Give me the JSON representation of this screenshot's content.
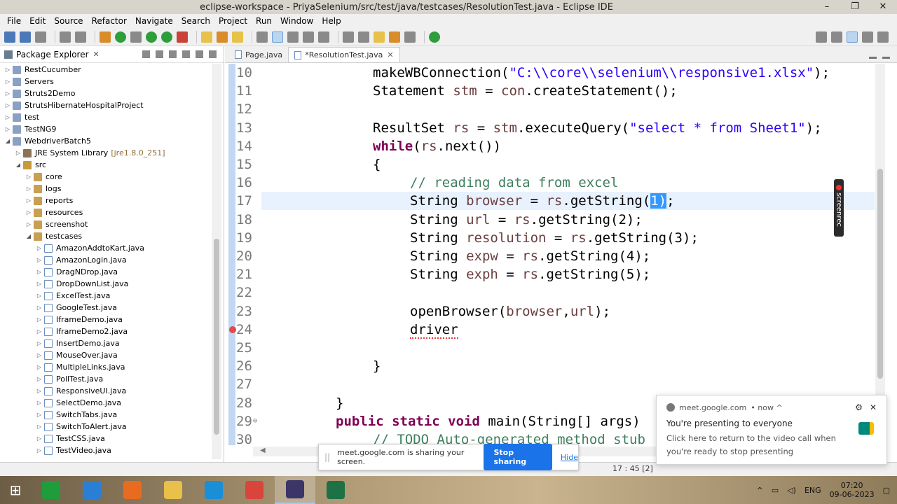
{
  "window": {
    "title": "eclipse-workspace - PriyaSelenium/src/test/java/testcases/ResolutionTest.java - Eclipse IDE",
    "controls": [
      "–",
      "❐",
      "✕"
    ]
  },
  "menu": [
    "File",
    "Edit",
    "Source",
    "Refactor",
    "Navigate",
    "Search",
    "Project",
    "Run",
    "Window",
    "Help"
  ],
  "explorer": {
    "title": "Package Explorer",
    "close": "✕",
    "items": [
      {
        "label": "RestCucumber",
        "arrow": "▷",
        "type": "proj",
        "indent": 0
      },
      {
        "label": "Servers",
        "arrow": "▷",
        "type": "proj",
        "indent": 0
      },
      {
        "label": "Struts2Demo",
        "arrow": "▷",
        "type": "proj",
        "indent": 0
      },
      {
        "label": "StrutsHibernateHospitalProject",
        "arrow": "▷",
        "type": "proj",
        "indent": 0
      },
      {
        "label": "test",
        "arrow": "▷",
        "type": "proj",
        "indent": 0
      },
      {
        "label": "TestNG9",
        "arrow": "▷",
        "type": "proj",
        "indent": 0
      },
      {
        "label": "WebdriverBatch5",
        "arrow": "◢",
        "type": "proj",
        "indent": 0
      },
      {
        "label": "JRE System Library",
        "extra": "[jre1.8.0_251]",
        "arrow": "▷",
        "type": "jar",
        "indent": 1
      },
      {
        "label": "src",
        "arrow": "◢",
        "type": "src",
        "indent": 1
      },
      {
        "label": "core",
        "arrow": "▷",
        "type": "pkg",
        "indent": 2
      },
      {
        "label": "logs",
        "arrow": "▷",
        "type": "pkg",
        "indent": 2
      },
      {
        "label": "reports",
        "arrow": "▷",
        "type": "pkg",
        "indent": 2
      },
      {
        "label": "resources",
        "arrow": "▷",
        "type": "pkg",
        "indent": 2
      },
      {
        "label": "screenshot",
        "arrow": "▷",
        "type": "pkg",
        "indent": 2
      },
      {
        "label": "testcases",
        "arrow": "◢",
        "type": "pkg",
        "indent": 2
      },
      {
        "label": "AmazonAddtoKart.java",
        "arrow": "▷",
        "type": "java",
        "indent": 3
      },
      {
        "label": "AmazonLogin.java",
        "arrow": "▷",
        "type": "java",
        "indent": 3
      },
      {
        "label": "DragNDrop.java",
        "arrow": "▷",
        "type": "java",
        "indent": 3
      },
      {
        "label": "DropDownList.java",
        "arrow": "▷",
        "type": "java",
        "indent": 3
      },
      {
        "label": "ExcelTest.java",
        "arrow": "▷",
        "type": "java",
        "indent": 3
      },
      {
        "label": "GoogleTest.java",
        "arrow": "▷",
        "type": "java",
        "indent": 3
      },
      {
        "label": "IframeDemo.java",
        "arrow": "▷",
        "type": "java",
        "indent": 3
      },
      {
        "label": "IframeDemo2.java",
        "arrow": "▷",
        "type": "java",
        "indent": 3
      },
      {
        "label": "InsertDemo.java",
        "arrow": "▷",
        "type": "java",
        "indent": 3
      },
      {
        "label": "MouseOver.java",
        "arrow": "▷",
        "type": "java",
        "indent": 3
      },
      {
        "label": "MultipleLinks.java",
        "arrow": "▷",
        "type": "java",
        "indent": 3
      },
      {
        "label": "PollTest.java",
        "arrow": "▷",
        "type": "java",
        "indent": 3
      },
      {
        "label": "ResponsiveUI.java",
        "arrow": "▷",
        "type": "java",
        "indent": 3
      },
      {
        "label": "SelectDemo.java",
        "arrow": "▷",
        "type": "java",
        "indent": 3
      },
      {
        "label": "SwitchTabs.java",
        "arrow": "▷",
        "type": "java",
        "indent": 3
      },
      {
        "label": "SwitchToAlert.java",
        "arrow": "▷",
        "type": "java",
        "indent": 3
      },
      {
        "label": "TestCSS.java",
        "arrow": "▷",
        "type": "java",
        "indent": 3
      },
      {
        "label": "TestVideo.java",
        "arrow": "▷",
        "type": "java",
        "indent": 3
      }
    ]
  },
  "editor": {
    "tabs": [
      {
        "label": "Page.java",
        "active": false
      },
      {
        "label": "*ResolutionTest.java",
        "active": true,
        "close": "✕"
      }
    ],
    "lines": [
      {
        "num": "10",
        "indent": 2,
        "tokens": [
          [
            "p",
            "makeWBConnection("
          ],
          [
            "s",
            "\"C:\\\\core\\\\selenium\\\\responsive1.xlsx\""
          ],
          [
            "p",
            ");"
          ]
        ]
      },
      {
        "num": "11",
        "indent": 2,
        "tokens": [
          [
            "p",
            "Statement "
          ],
          [
            "v",
            "stm"
          ],
          [
            "p",
            " = "
          ],
          [
            "v",
            "con"
          ],
          [
            "p",
            ".createStatement();"
          ]
        ]
      },
      {
        "num": "12",
        "indent": 0,
        "tokens": []
      },
      {
        "num": "13",
        "indent": 2,
        "tokens": [
          [
            "p",
            "ResultSet "
          ],
          [
            "v",
            "rs"
          ],
          [
            "p",
            " = "
          ],
          [
            "v",
            "stm"
          ],
          [
            "p",
            ".executeQuery("
          ],
          [
            "s",
            "\"select * from Sheet1\""
          ],
          [
            "p",
            ");"
          ]
        ]
      },
      {
        "num": "14",
        "indent": 2,
        "tokens": [
          [
            "k",
            "while"
          ],
          [
            "p",
            "("
          ],
          [
            "v",
            "rs"
          ],
          [
            "p",
            ".next())"
          ]
        ]
      },
      {
        "num": "15",
        "indent": 2,
        "tokens": [
          [
            "p",
            "{"
          ]
        ]
      },
      {
        "num": "16",
        "indent": 3,
        "tokens": [
          [
            "c",
            "// reading data from excel"
          ]
        ]
      },
      {
        "num": "17",
        "indent": 3,
        "current": true,
        "tokens": [
          [
            "p",
            "String "
          ],
          [
            "v",
            "browser"
          ],
          [
            "p",
            " = "
          ],
          [
            "v",
            "rs"
          ],
          [
            "p",
            ".getString("
          ],
          [
            "sel",
            "1)"
          ],
          [
            "p",
            ";"
          ]
        ]
      },
      {
        "num": "18",
        "indent": 3,
        "tokens": [
          [
            "p",
            "String "
          ],
          [
            "v",
            "url"
          ],
          [
            "p",
            " = "
          ],
          [
            "v",
            "rs"
          ],
          [
            "p",
            ".getString(2);"
          ]
        ]
      },
      {
        "num": "19",
        "indent": 3,
        "tokens": [
          [
            "p",
            "String "
          ],
          [
            "v",
            "resolution"
          ],
          [
            "p",
            " = "
          ],
          [
            "v",
            "rs"
          ],
          [
            "p",
            ".getString(3);"
          ]
        ]
      },
      {
        "num": "20",
        "indent": 3,
        "tokens": [
          [
            "p",
            "String "
          ],
          [
            "v",
            "expw"
          ],
          [
            "p",
            " = "
          ],
          [
            "v",
            "rs"
          ],
          [
            "p",
            ".getString(4);"
          ]
        ]
      },
      {
        "num": "21",
        "indent": 3,
        "tokens": [
          [
            "p",
            "String "
          ],
          [
            "v",
            "exph"
          ],
          [
            "p",
            " = "
          ],
          [
            "v",
            "rs"
          ],
          [
            "p",
            ".getString(5);"
          ]
        ]
      },
      {
        "num": "22",
        "indent": 0,
        "tokens": []
      },
      {
        "num": "23",
        "indent": 3,
        "tokens": [
          [
            "p",
            "openBrowser("
          ],
          [
            "v",
            "browser"
          ],
          [
            "p",
            ","
          ],
          [
            "v",
            "url"
          ],
          [
            "p",
            ");"
          ]
        ]
      },
      {
        "num": "24",
        "indent": 3,
        "error": true,
        "tokens": [
          [
            "e",
            "driver"
          ]
        ]
      },
      {
        "num": "25",
        "indent": 0,
        "tokens": []
      },
      {
        "num": "26",
        "indent": 2,
        "tokens": [
          [
            "p",
            "}"
          ]
        ]
      },
      {
        "num": "27",
        "indent": 0,
        "tokens": []
      },
      {
        "num": "28",
        "indent": 1,
        "tokens": [
          [
            "p",
            "}"
          ]
        ]
      },
      {
        "num": "29",
        "indent": 1,
        "fold": "⊖",
        "tokens": [
          [
            "k",
            "public static void "
          ],
          [
            "p",
            "main(String[] args)"
          ]
        ]
      },
      {
        "num": "30",
        "indent": 2,
        "tokens": [
          [
            "c",
            "// TODO Auto-generated method stub"
          ]
        ]
      }
    ],
    "screenrec_label": "screenrec"
  },
  "status": {
    "position": "17 : 45 [2]"
  },
  "share_banner": {
    "message": "meet.google.com is sharing your screen.",
    "stop": "Stop sharing",
    "hide": "Hide"
  },
  "notification": {
    "source": "meet.google.com",
    "time": "• now ^",
    "title": "You're presenting to everyone",
    "body": "Click here to return to the video call when you're ready to stop presenting"
  },
  "taskbar": {
    "apps": [
      {
        "name": "camtasia",
        "color": "#1f9d3a"
      },
      {
        "name": "internet-explorer",
        "color": "#2a7fd4"
      },
      {
        "name": "firefox",
        "color": "#e86b1f"
      },
      {
        "name": "file-explorer",
        "color": "#e8c04a"
      },
      {
        "name": "edge",
        "color": "#1a8fd8"
      },
      {
        "name": "chrome",
        "color": "#d9453a"
      },
      {
        "name": "eclipse",
        "color": "#3b3568",
        "active": true
      },
      {
        "name": "excel",
        "color": "#1e7145"
      }
    ],
    "lang": "ENG",
    "time": "07:20",
    "date": "09-06-2023"
  }
}
